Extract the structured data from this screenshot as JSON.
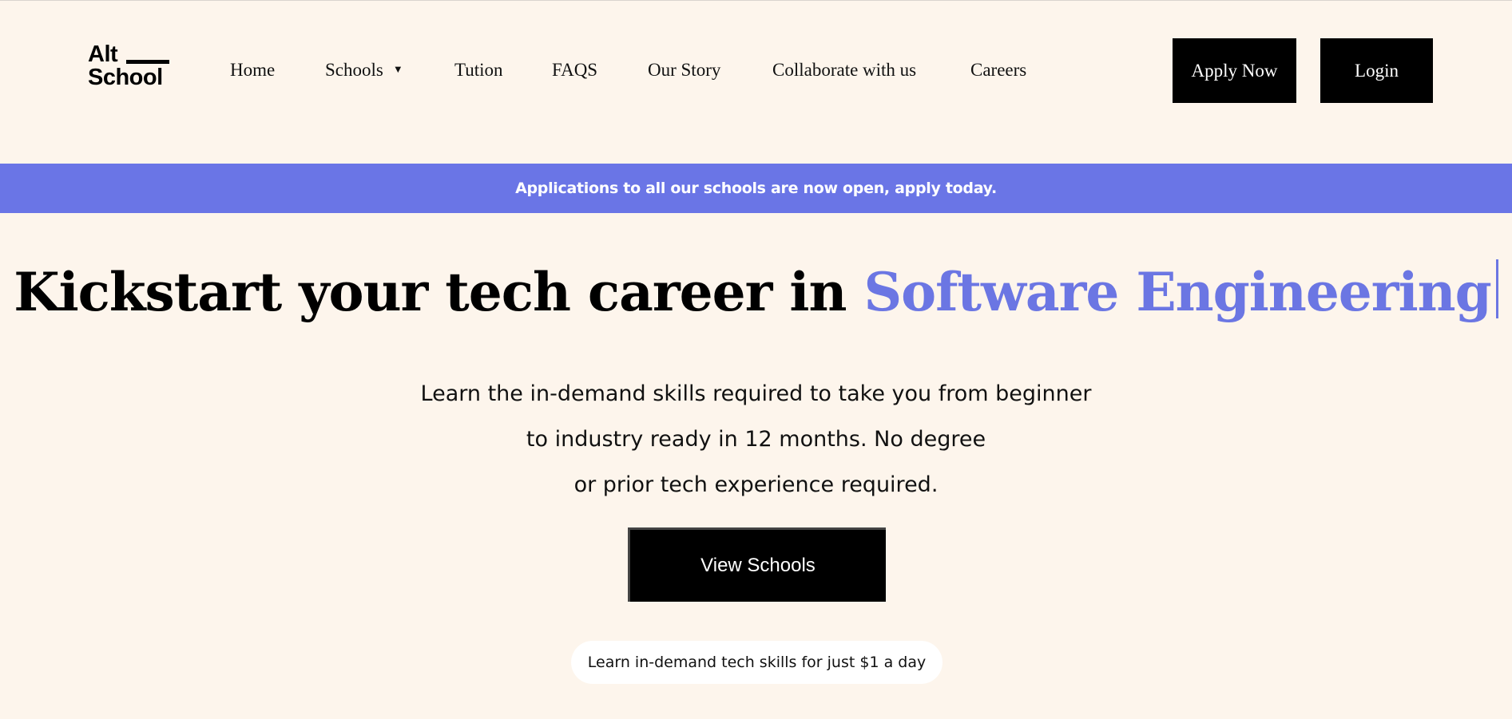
{
  "logo": {
    "line1": "Alt",
    "line2": "School"
  },
  "nav": {
    "items": [
      {
        "label": "Home"
      },
      {
        "label": "Schools",
        "caret": "▼"
      },
      {
        "label": "Tution"
      },
      {
        "label": "FAQS"
      },
      {
        "label": "Our Story"
      },
      {
        "label": "Collaborate with us"
      },
      {
        "label": "Careers"
      }
    ]
  },
  "header_buttons": {
    "apply": "Apply Now",
    "login": "Login"
  },
  "banner": {
    "text": "Applications to all our schools are now open, apply today."
  },
  "hero": {
    "title_prefix": "Kickstart your tech career in",
    "title_accent": "Software Engineering",
    "subtitle_lines": [
      "Learn the in-demand skills required to take you from beginner",
      "to industry ready in 12 months. No degree",
      "or prior tech experience required."
    ],
    "cta": "View Schools",
    "pill": "Learn in-demand tech skills for just $1 a day"
  },
  "colors": {
    "background": "#fdf5ec",
    "accent": "#6b76e3",
    "banner": "#6a75e6",
    "button": "#000000"
  }
}
